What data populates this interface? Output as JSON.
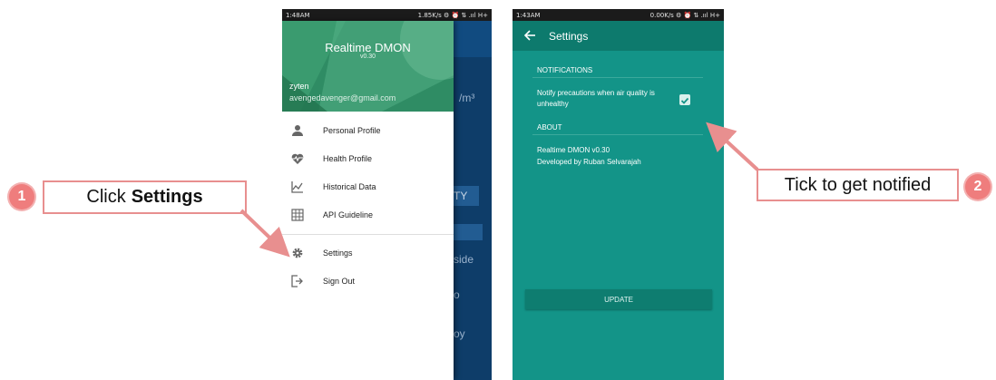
{
  "callouts": {
    "step1": {
      "number": "1",
      "text": "Click",
      "bold": "Settings"
    },
    "step2": {
      "number": "2",
      "text": "Tick to get notified"
    }
  },
  "phone1": {
    "status": {
      "time": "1:48AM",
      "right": "1.85K/s ⚙ ⏰ ⇅ .ııl H+"
    },
    "drawer": {
      "app_title": "Realtime DMON",
      "app_version": "v0.30",
      "user_name": "zyten",
      "user_email": "avengedavenger@gmail.com",
      "items": [
        {
          "label": "Personal Profile",
          "icon": "person-icon"
        },
        {
          "label": "Health Profile",
          "icon": "heartbeat-icon"
        },
        {
          "label": "Historical Data",
          "icon": "line-chart-icon"
        },
        {
          "label": "API Guideline",
          "icon": "grid-icon"
        },
        {
          "label": "Settings",
          "icon": "gear-icon"
        },
        {
          "label": "Sign Out",
          "icon": "sign-out-icon"
        }
      ]
    },
    "background": {
      "unit": "/m³",
      "label1": "TY",
      "label2": "side",
      "label3": "o",
      "label4": "oy"
    }
  },
  "phone2": {
    "status": {
      "time": "1:43AM",
      "right": "0.00K/s ⚙ ⏰ ⇅ .ııl H+"
    },
    "appbar_title": "Settings",
    "notifications_header": "NOTIFICATIONS",
    "notify_pref": "Notify precautions when air quality is unhealthy",
    "notify_checked": true,
    "about_header": "ABOUT",
    "about_line1": "Realtime DMON v0.30",
    "about_line2": "Developed by Ruban Selvarajah",
    "update_label": "UPDATE"
  },
  "colors": {
    "accent_red": "#e88f8f",
    "drawer_header": "#2f8c64",
    "settings_bg": "#139488",
    "settings_bar": "#0d7a6d"
  }
}
